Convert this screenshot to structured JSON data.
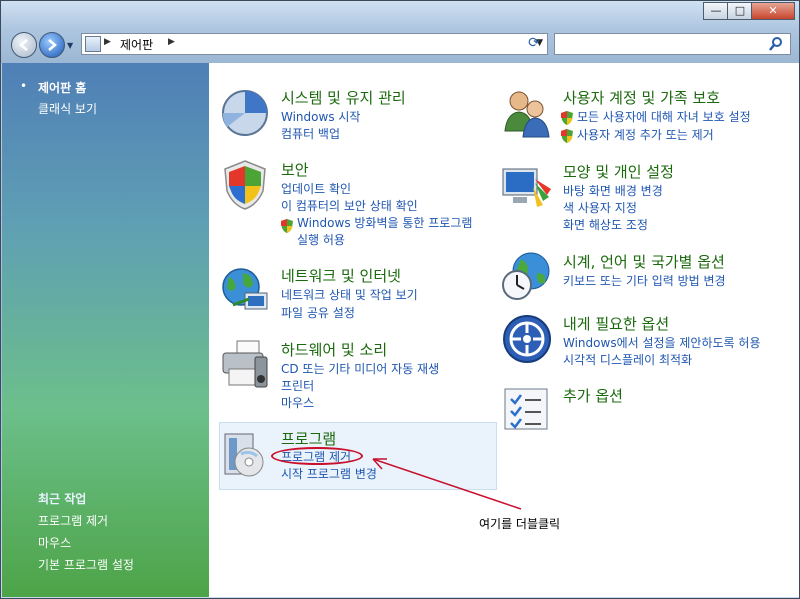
{
  "window": {
    "controls": {
      "minimize": "—",
      "maximize": "□",
      "close": "✕"
    }
  },
  "address": {
    "crumb": "제어판",
    "icons": [
      "back-icon",
      "forward-icon",
      "refresh-icon",
      "search-icon"
    ]
  },
  "search": {
    "placeholder": ""
  },
  "sidebar": {
    "home": "제어판 홈",
    "classic": "클래식 보기",
    "recent_header": "최근 작업",
    "recent": [
      "프로그램 제거",
      "마우스",
      "기본 프로그램 설정"
    ]
  },
  "categories": {
    "system": {
      "title": "시스템 및 유지 관리",
      "links": [
        "Windows 시작",
        "컴퓨터 백업"
      ]
    },
    "security": {
      "title": "보안",
      "links": [
        "업데이트 확인",
        "이 컴퓨터의 보안 상태 확인",
        "Windows 방화벽을 통한 프로그램",
        "실행 허용"
      ]
    },
    "network": {
      "title": "네트워크 및 인터넷",
      "links": [
        "네트워크 상태 및 작업 보기",
        "파일 공유 설정"
      ]
    },
    "hardware": {
      "title": "하드웨어 및 소리",
      "links": [
        "CD 또는 기타 미디어 자동 재생",
        "프린터",
        "마우스"
      ]
    },
    "programs": {
      "title": "프로그램",
      "links": [
        "프로그램 제거",
        "시작 프로그램 변경"
      ]
    },
    "users": {
      "title": "사용자 계정 및 가족 보호",
      "links": [
        "모든 사용자에 대해 자녀 보호 설정",
        "사용자 계정 추가 또는 제거"
      ]
    },
    "appearance": {
      "title": "모양 및 개인 설정",
      "links": [
        "바탕 화면 배경 변경",
        "색 사용자 지정",
        "화면 해상도 조정"
      ]
    },
    "clock": {
      "title": "시계, 언어 및 국가별 옵션",
      "links": [
        "키보드 또는 기타 입력 방법 변경"
      ]
    },
    "ease": {
      "title": "내게 필요한 옵션",
      "links": [
        "Windows에서 설정을 제안하도록 허용",
        "시각적 디스플레이 최적화"
      ]
    },
    "additional": {
      "title": "추가 옵션",
      "links": []
    }
  },
  "annotation": {
    "text": "여기를 더블클릭"
  },
  "colors": {
    "title_green": "#1b6a0d",
    "link_blue": "#1f56b0",
    "annotation_red": "#c8102e"
  }
}
